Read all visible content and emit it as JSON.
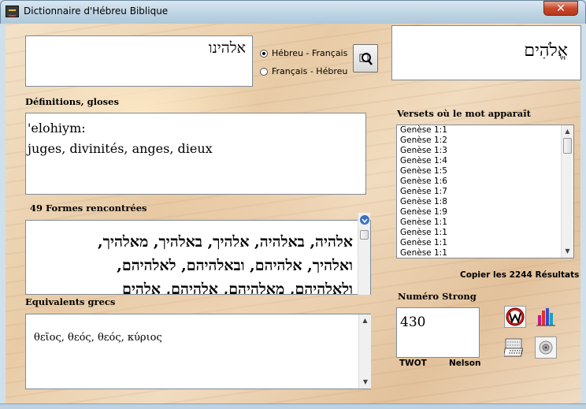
{
  "window": {
    "title": "Dictionnaire d'Hébreu Biblique",
    "close_glyph": "✕"
  },
  "search": {
    "value": "אלהינו",
    "modes": [
      {
        "label": "Hébreu - Français",
        "selected": true
      },
      {
        "label": "Français - Hébreu",
        "selected": false
      }
    ],
    "result_word": "אֱלֹהִים"
  },
  "definitions": {
    "label": "Définitions, gloses",
    "lines": [
      "'elohiym:",
      "juges, divinités, anges, dieux"
    ]
  },
  "forms": {
    "label": "49 Formes rencontrées",
    "lines": [
      "אלהיה, באלהיה, אלהיך, באלהיך, מאלהיך,",
      "ואלהיך, אלהיהם, ובאלהיהם, לאלהיהם,",
      "ולאלהיהם, מאלהיהם, אלהיהם, אלהים"
    ]
  },
  "greek": {
    "label": "Equivalents grecs",
    "value": "θεῖος, θεός, θεός, κύριος"
  },
  "verses": {
    "label": "Versets où le mot apparaît",
    "items": [
      "Genèse 1:1",
      "Genèse 1:2",
      "Genèse 1:3",
      "Genèse 1:4",
      "Genèse 1:5",
      "Genèse 1:6",
      "Genèse 1:7",
      "Genèse 1:8",
      "Genèse 1:9",
      "Genèse 1:1",
      "Genèse 1:1",
      "Genèse 1:1",
      "Genèse 1:1"
    ],
    "copy_label": "Copier les 2244 Résultats"
  },
  "strong": {
    "label": "Numéro Strong",
    "value": "430",
    "twot_label": "TWOT",
    "nelson_label": "Nelson"
  },
  "icons": [
    "magnifier-icon",
    "w-logo-icon",
    "bar-chart-icon",
    "keyboard-icon",
    "speaker-icon"
  ]
}
